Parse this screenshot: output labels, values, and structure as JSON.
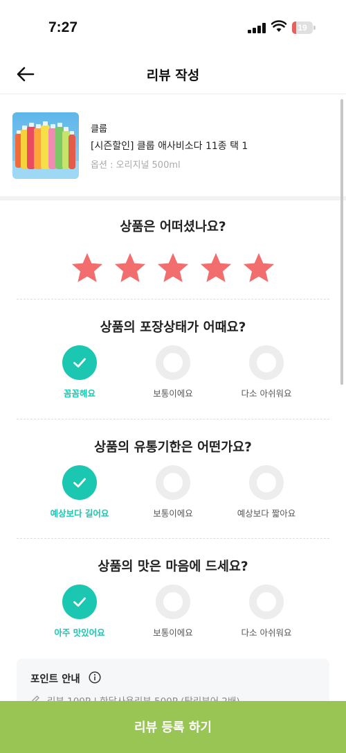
{
  "status_bar": {
    "time": "7:27",
    "battery": "19",
    "battery_level": 0.19
  },
  "header": {
    "title": "리뷰 작성",
    "back_icon": "arrow-left-icon"
  },
  "product": {
    "brand": "클룹",
    "name": "[시즌할인] 클룹 애사비소다 11종 택 1",
    "option": "옵션 : 오리지널 500ml"
  },
  "rating": {
    "question": "상품은 어떠셨나요?",
    "stars": 5,
    "max_stars": 5,
    "star_color": "#f26d6d"
  },
  "questions": [
    {
      "question": "상품의 포장상태가 어때요?",
      "options": [
        "꼼꼼해요",
        "보통이에요",
        "다소 아쉬워요"
      ],
      "selected": 0
    },
    {
      "question": "상품의 유통기한은 어떤가요?",
      "options": [
        "예상보다 길어요",
        "보통이에요",
        "예상보다 짧아요"
      ],
      "selected": 0
    },
    {
      "question": "상품의 맛은 마음에 드세요?",
      "options": [
        "아주 맛있어요",
        "보통이에요",
        "다소 아쉬워요"
      ],
      "selected": 0
    }
  ],
  "point_info": {
    "title": "포인트 안내",
    "text": "리뷰 100P | 한달사용리뷰 500P (탑리뷰어 2배)"
  },
  "submit": {
    "label": "리뷰 등록 하기"
  },
  "colors": {
    "accent": "#1bc7b0",
    "submit_bg": "#98c554",
    "star": "#f26d6d"
  }
}
